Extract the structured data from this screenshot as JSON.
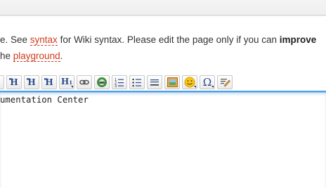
{
  "intro": {
    "line1_start": "e. See ",
    "line1_link": "syntax",
    "line1_mid": " for Wiki syntax. Please edit the page only if you can ",
    "line1_bold": "improve",
    "line2_start": "he ",
    "line2_link": "playground",
    "line2_end": "."
  },
  "toolbar": {
    "buttons": [
      "partial-button",
      "heading-same-level",
      "heading-lower-level",
      "heading-higher-level",
      "heading-select",
      "link",
      "external-link",
      "ordered-list",
      "unordered-list",
      "horizontal-rule",
      "insert-media",
      "smileys",
      "special-chars",
      "signature"
    ]
  },
  "colors": {
    "link": "#d03a1c",
    "editor_border": "#4da0e0",
    "toolbar_icon": "#2a4d8e"
  },
  "editor": {
    "content": "umentation Center"
  }
}
